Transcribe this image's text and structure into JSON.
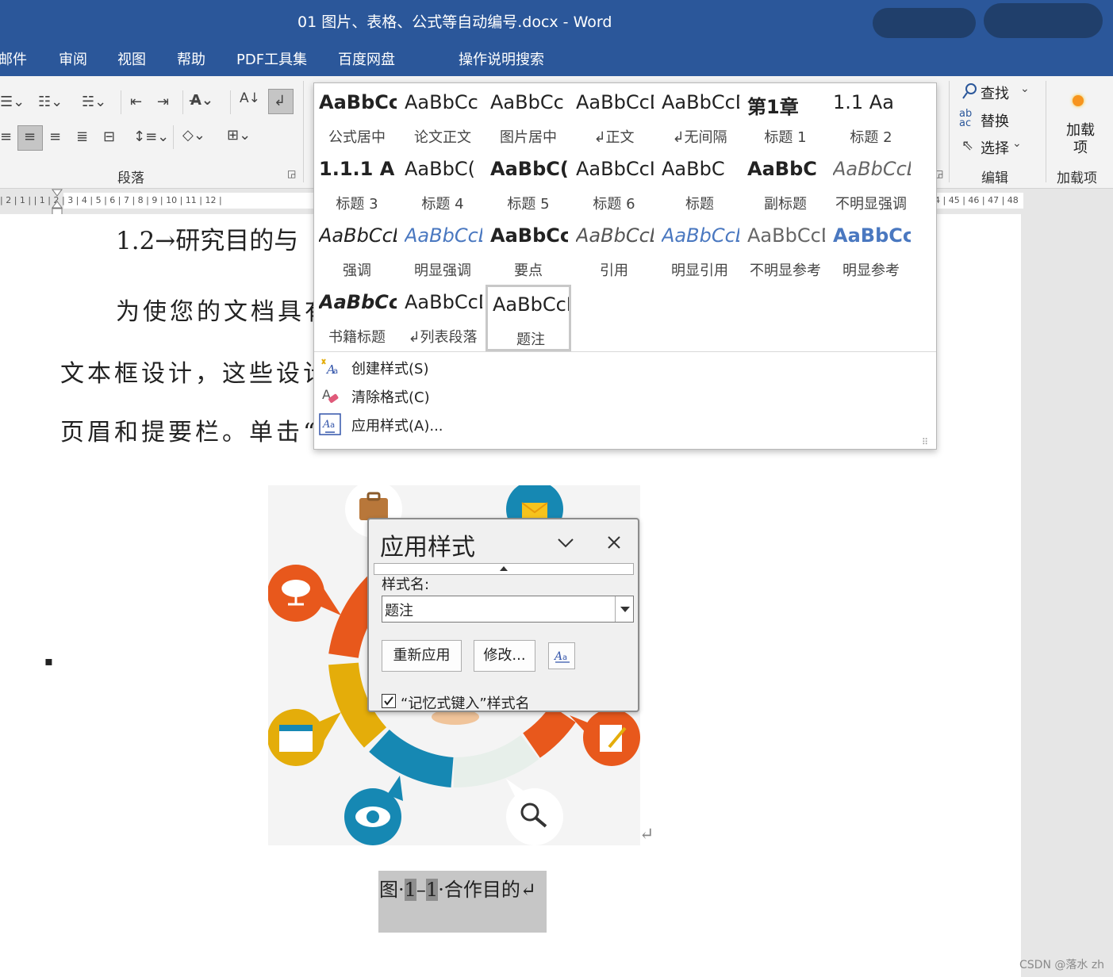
{
  "titlebar": {
    "title": "01 图片、表格、公式等自动编号.docx  -  Word"
  },
  "tabs": [
    "邮件",
    "审阅",
    "视图",
    "帮助",
    "PDF工具集",
    "百度网盘",
    "操作说明搜索"
  ],
  "ribbon": {
    "paragraph_group_label": "段落",
    "editing": {
      "find": "查找",
      "replace": "替换",
      "select": "选择",
      "group_label": "编辑"
    },
    "addins": {
      "button": "加载项",
      "group_label": "加载项"
    }
  },
  "ruler": {
    "text": "| 2 | 1 |     | 1 | 2 | 3 | 4 | 5 | 6 | 7 | 8 | 9 | 10 | 11 | 12 |",
    "right_text": "4 | 45 | 46 | 47 | 48"
  },
  "document": {
    "heading": "1.2→研究目的与",
    "line1": "为使您的文档具有",
    "line2": "文本框设计，这些设计",
    "line3": "页眉和提要栏。单击“",
    "caption": {
      "prefix": "图·",
      "num1": "1",
      "dash": "–",
      "num2": "1",
      "suffix": "·合作目的↵"
    },
    "return_mark": "↵",
    "bullet": "▪"
  },
  "gallery": {
    "styles": [
      {
        "sample": "AaBbCcDı",
        "name": "公式居中",
        "weight": "bold",
        "style": "normal",
        "color": "#222222"
      },
      {
        "sample": "AaBbCc",
        "name": "论文正文",
        "weight": "normal",
        "style": "normal",
        "color": "#222222"
      },
      {
        "sample": "AaBbCc",
        "name": "图片居中",
        "weight": "normal",
        "style": "normal",
        "color": "#222222"
      },
      {
        "sample": "AaBbCcDc",
        "name": "↲正文",
        "weight": "normal",
        "style": "normal",
        "color": "#222222"
      },
      {
        "sample": "AaBbCcDc",
        "name": "↲无间隔",
        "weight": "normal",
        "style": "normal",
        "color": "#222222"
      },
      {
        "sample": "第1章",
        "name": "标题 1",
        "weight": "bold",
        "style": "normal",
        "color": "#222222"
      },
      {
        "sample": "1.1  Aa",
        "name": "标题 2",
        "weight": "normal",
        "style": "normal",
        "color": "#222222"
      },
      {
        "sample": "1.1.1  A",
        "name": "标题 3",
        "weight": "bold",
        "style": "normal",
        "color": "#222222"
      },
      {
        "sample": "AaBbC(",
        "name": "标题 4",
        "weight": "normal",
        "style": "normal",
        "color": "#222222"
      },
      {
        "sample": "AaBbC(",
        "name": "标题 5",
        "weight": "bold",
        "style": "normal",
        "color": "#222222"
      },
      {
        "sample": "AaBbCcI",
        "name": "标题 6",
        "weight": "normal",
        "style": "normal",
        "color": "#222222"
      },
      {
        "sample": "AaBbC",
        "name": "标题",
        "weight": "normal",
        "style": "normal",
        "color": "#222222"
      },
      {
        "sample": "AaBbC",
        "name": "副标题",
        "weight": "bold",
        "style": "normal",
        "color": "#222222"
      },
      {
        "sample": "AaBbCcD",
        "name": "不明显强调",
        "weight": "normal",
        "style": "italic",
        "color": "#666666"
      },
      {
        "sample": "AaBbCcD",
        "name": "强调",
        "weight": "normal",
        "style": "italic",
        "color": "#222222"
      },
      {
        "sample": "AaBbCcD",
        "name": "明显强调",
        "weight": "normal",
        "style": "italic",
        "color": "#4a78c0"
      },
      {
        "sample": "AaBbCcDı",
        "name": "要点",
        "weight": "bold",
        "style": "normal",
        "color": "#222222"
      },
      {
        "sample": "AaBbCcD",
        "name": "引用",
        "weight": "normal",
        "style": "italic",
        "color": "#555555"
      },
      {
        "sample": "AaBbCcD",
        "name": "明显引用",
        "weight": "normal",
        "style": "italic",
        "color": "#4a78c0"
      },
      {
        "sample": "AaBbCcDı",
        "name": "不明显参考",
        "weight": "normal",
        "style": "normal",
        "color": "#666666"
      },
      {
        "sample": "AaBbCcD",
        "name": "明显参考",
        "weight": "bold",
        "style": "normal",
        "color": "#4a78c0"
      },
      {
        "sample": "AaBbCcD",
        "name": "书籍标题",
        "weight": "bold",
        "style": "italic",
        "color": "#222222"
      },
      {
        "sample": "AaBbCcDc",
        "name": "↲列表段落",
        "weight": "normal",
        "style": "normal",
        "color": "#222222"
      },
      {
        "sample": "AaBbCcD(",
        "name": "题注",
        "weight": "normal",
        "style": "normal",
        "color": "#222222"
      }
    ],
    "menu": [
      "创建样式(S)",
      "清除格式(C)",
      "应用样式(A)..."
    ]
  },
  "dialog": {
    "title": "应用样式",
    "style_name_label": "样式名:",
    "style_name_value": "题注",
    "reapply": "重新应用",
    "modify": "修改...",
    "autocomplete_label": "“记忆式键入”样式名",
    "autocomplete_checked": true
  },
  "watermark": "CSDN @落水 zh",
  "colors": {
    "titlebar": "#2b579a",
    "accent_orange": "#e8581c",
    "accent_blue": "#1688b3",
    "accent_yellow": "#e4ad0a"
  }
}
